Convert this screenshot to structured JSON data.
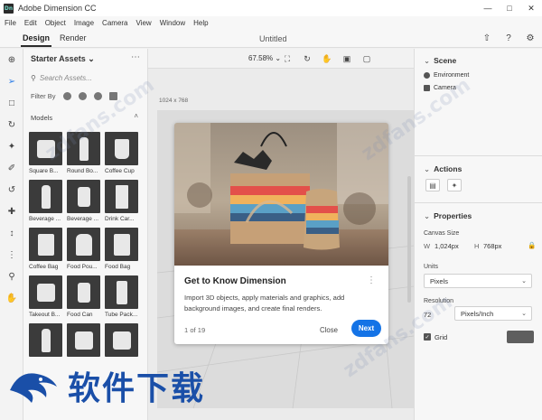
{
  "window": {
    "title": "Adobe Dimension CC",
    "logo_text": "Dn"
  },
  "menu": [
    "File",
    "Edit",
    "Object",
    "Image",
    "Camera",
    "View",
    "Window",
    "Help"
  ],
  "modes": {
    "design": "Design",
    "render": "Render",
    "active": "Design"
  },
  "document": {
    "title": "Untitled"
  },
  "assets": {
    "header": "Starter Assets",
    "search_placeholder": "Search Assets...",
    "filter_label": "Filter By",
    "section": "Models",
    "items": [
      {
        "label": "Square B...",
        "shape": "box"
      },
      {
        "label": "Round Bo...",
        "shape": "bottle"
      },
      {
        "label": "Coffee Cup",
        "shape": "cup"
      },
      {
        "label": "Beverage ...",
        "shape": "bottle"
      },
      {
        "label": "Beverage ...",
        "shape": "can"
      },
      {
        "label": "Drink Car...",
        "shape": "carton"
      },
      {
        "label": "Coffee Bag",
        "shape": "bag"
      },
      {
        "label": "Food Pou...",
        "shape": "pouch"
      },
      {
        "label": "Food Bag",
        "shape": "bag"
      },
      {
        "label": "Takeout B...",
        "shape": "box"
      },
      {
        "label": "Food Can",
        "shape": "can"
      },
      {
        "label": "Tube Pack...",
        "shape": "tube"
      },
      {
        "label": "",
        "shape": "bottle"
      },
      {
        "label": "",
        "shape": "box"
      },
      {
        "label": "",
        "shape": "box"
      }
    ]
  },
  "canvas": {
    "zoom": "67.58%",
    "size_label": "1024 x 768"
  },
  "welcome": {
    "title": "Get to Know Dimension",
    "body": "Import 3D objects, apply materials and graphics, add background images, and create final renders.",
    "page": "1 of 19",
    "close": "Close",
    "next": "Next"
  },
  "scene": {
    "header": "Scene",
    "environment": "Environment",
    "camera": "Camera"
  },
  "actions": {
    "header": "Actions"
  },
  "properties": {
    "header": "Properties",
    "canvas_size_label": "Canvas Size",
    "w_label": "W",
    "w_value": "1,024px",
    "h_label": "H",
    "h_value": "768px",
    "units_label": "Units",
    "units_value": "Pixels",
    "resolution_label": "Resolution",
    "resolution_value": "72",
    "resolution_unit": "Pixels/Inch",
    "grid_label": "Grid"
  },
  "watermark": {
    "text": "zdfans.com",
    "brand": "软件下载"
  },
  "colors": {
    "accent": "#1473e6",
    "thumb_bg": "#3b3b3b",
    "brand": "#1a4fa8"
  }
}
